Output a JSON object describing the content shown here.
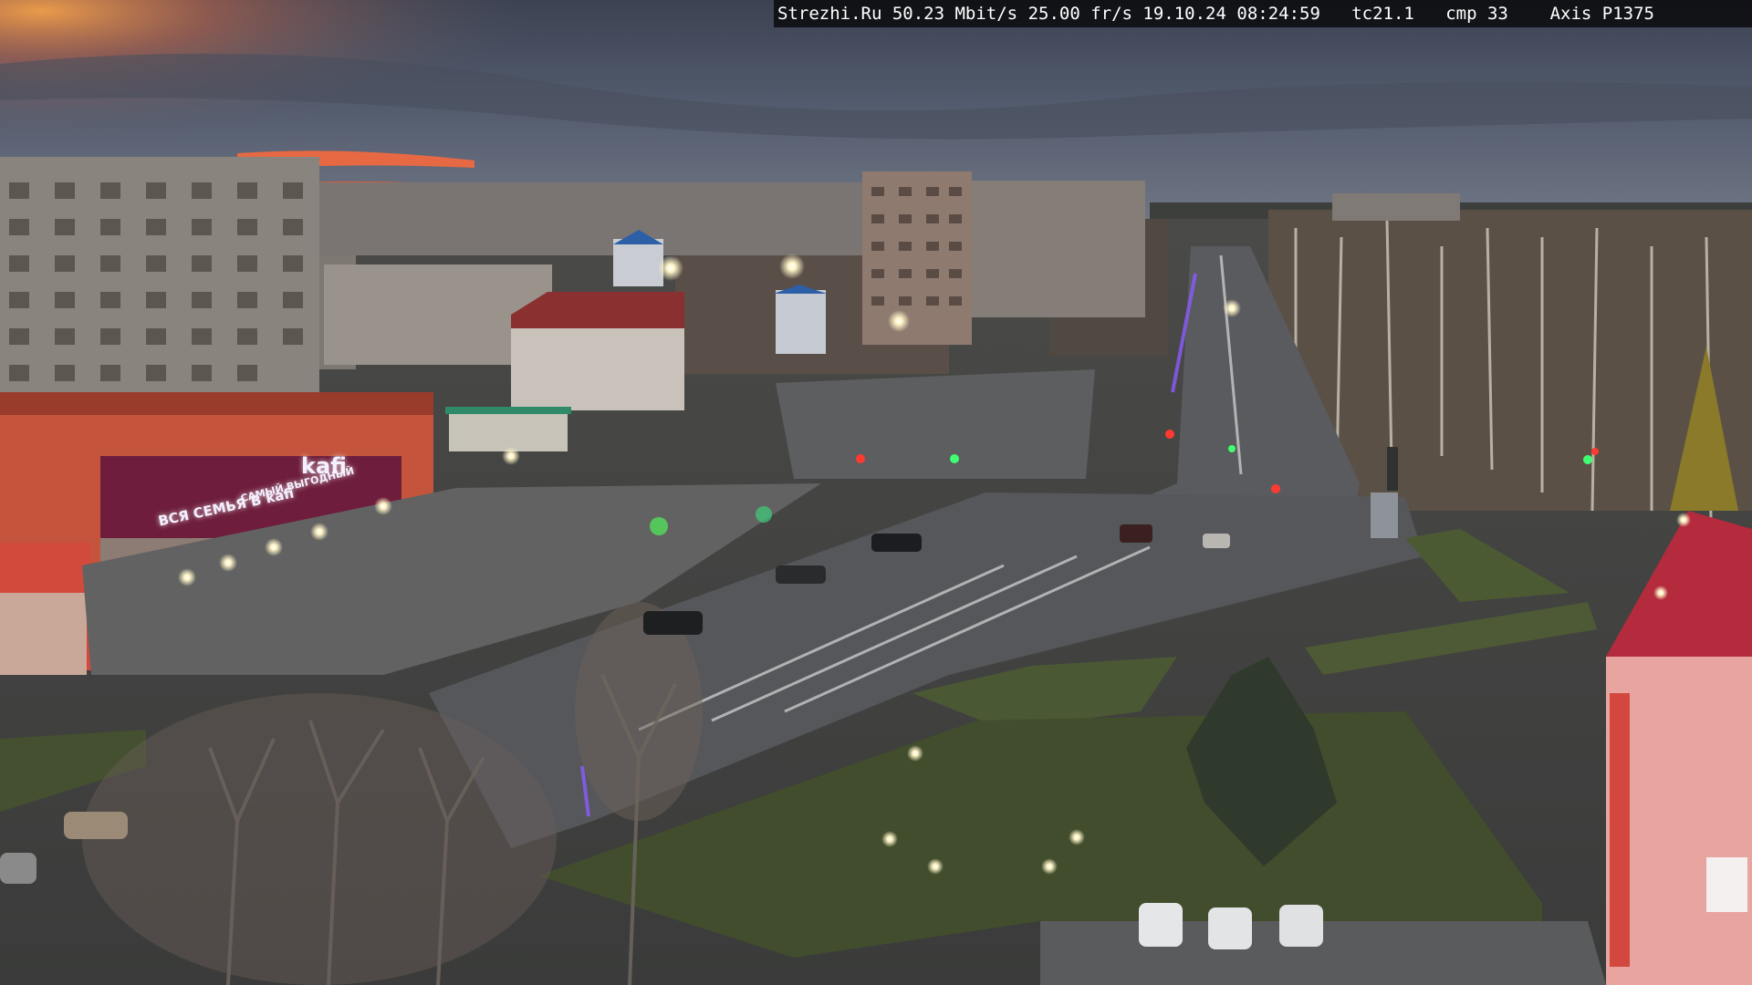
{
  "overlay": {
    "site": "Strezhi.Ru",
    "bitrate": "50.23 Mbit/s",
    "framerate": "25.00 fr/s",
    "date": "19.10.24",
    "time": "08:24:59",
    "tc": "tc21.1",
    "cmp": "cmp 33",
    "camera": "Axis P1375"
  },
  "signs": {
    "cafe_rooftop": "kafi",
    "cafe_front": "ВСЯ СЕМЬЯ В kafi",
    "store_banner": "САМЫЙ ВЫГОДНЫЙ"
  },
  "colors": {
    "sky_top": "#3b4150",
    "sky_glow": "#e07a3a",
    "road": "#56585d",
    "grass": "#3f4a30",
    "brick_red": "#b2473a",
    "cafe_magenta": "#7a1f3f"
  }
}
